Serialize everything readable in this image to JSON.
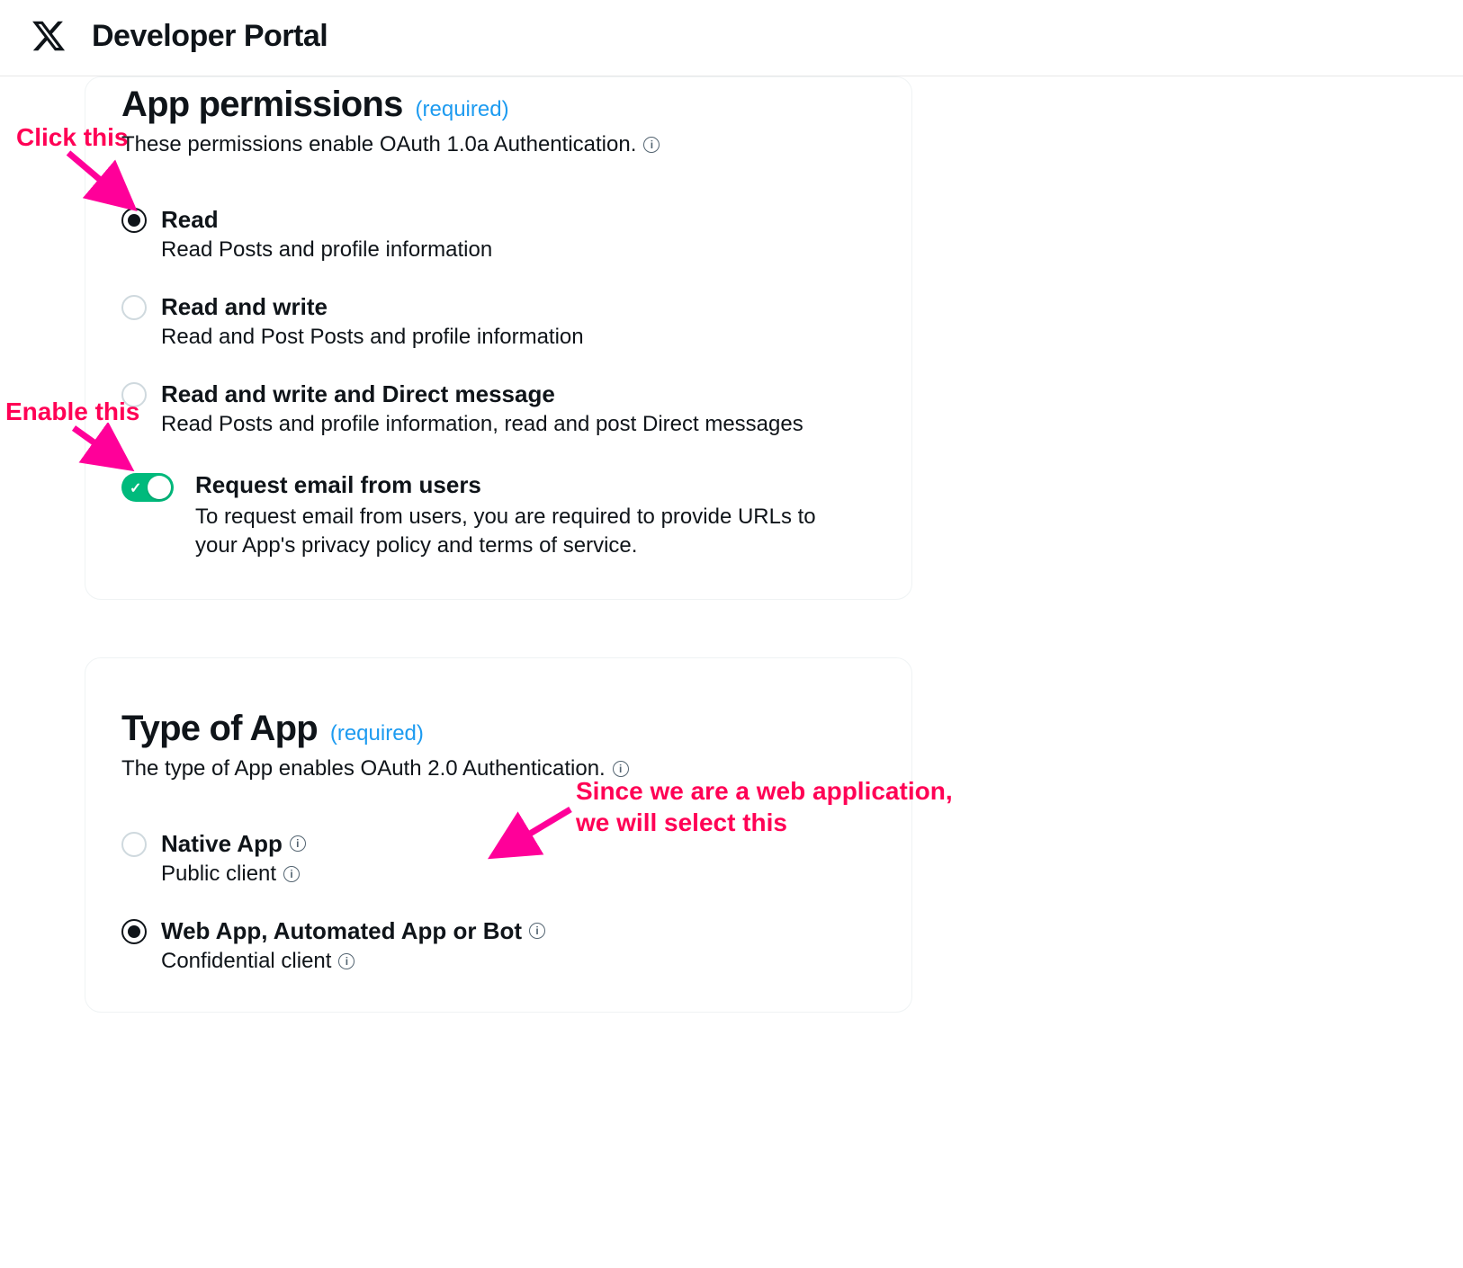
{
  "header": {
    "title": "Developer Portal"
  },
  "permissions": {
    "title": "App permissions",
    "required_label": "(required)",
    "description": "These permissions enable OAuth 1.0a Authentication.",
    "options": [
      {
        "label": "Read",
        "sub": "Read Posts and profile information",
        "selected": true
      },
      {
        "label": "Read and write",
        "sub": "Read and Post Posts and profile information",
        "selected": false
      },
      {
        "label": "Read and write and Direct message",
        "sub": "Read Posts and profile information, read and post Direct messages",
        "selected": false
      }
    ],
    "email_toggle": {
      "label": "Request email from users",
      "description": "To request email from users, you are required to provide URLs to your App's privacy policy and terms of service.",
      "on": true
    }
  },
  "app_type": {
    "title": "Type of App",
    "required_label": "(required)",
    "description": "The type of App enables OAuth 2.0 Authentication.",
    "options": [
      {
        "label": "Native App",
        "sub": "Public client",
        "selected": false
      },
      {
        "label": "Web App, Automated App or Bot",
        "sub": "Confidential client",
        "selected": true
      }
    ]
  },
  "annotations": {
    "click_this": "Click this",
    "enable_this": "Enable this",
    "web_app_hint": "Since we are a web application,\nwe will select this"
  }
}
